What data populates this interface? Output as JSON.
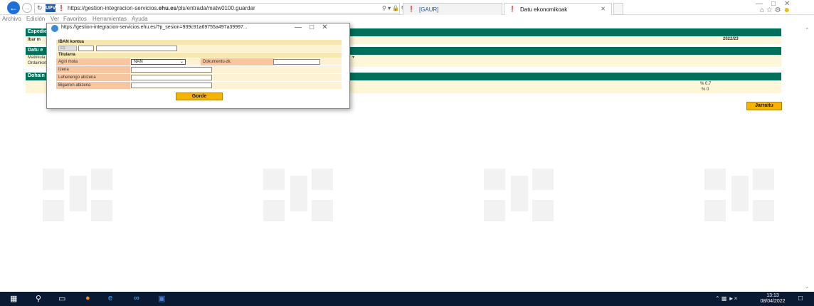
{
  "browser": {
    "url_prefix": "https://gestion-integracion-servicios.",
    "url_domain": "ehu.es",
    "url_suffix": "/pls/entrada/matw0100.guardar",
    "tabs": [
      {
        "label": "[GAUR]"
      },
      {
        "label": "Datu ekonomikoak"
      }
    ]
  },
  "menu": [
    "Archivo",
    "Edición",
    "Ver",
    "Favoritos",
    "Herramientas",
    "Ayuda"
  ],
  "page": {
    "band1": "Espedie",
    "row_label": "Ibar m",
    "year": "2022/23",
    "band2": "Datu e",
    "row_matrikula": "Matrikula",
    "row_ordainketa": "Ordainketa",
    "band3": "Dohain",
    "pct1": "% 0.7",
    "pct2": "% 0",
    "continue_button": "Jarraitu"
  },
  "popup": {
    "url": "https://gestion-integracion-servicios.ehu.es/?p_sesion=939c91a69755a497a39997...",
    "iban_heading": "IBAN kontua",
    "iban_country": "ES",
    "titularra_heading": "Titularra",
    "agiri_mota_label": "Agiri mota",
    "agiri_mota_value": "NAN",
    "dokumentu_label": "Dokumentu-zk.",
    "izena_label": "Izena",
    "lehen_abizena_label": "Lehenengo abizena",
    "bigarren_abizena_label": "Bigarren abizena",
    "save_button": "Gorde"
  },
  "taskbar": {
    "time": "13:13",
    "date": "08/04/2022"
  },
  "colors": {
    "accent_green": "#00705a",
    "button_orange": "#f5b400",
    "label_salmon": "#f7c6a0"
  }
}
